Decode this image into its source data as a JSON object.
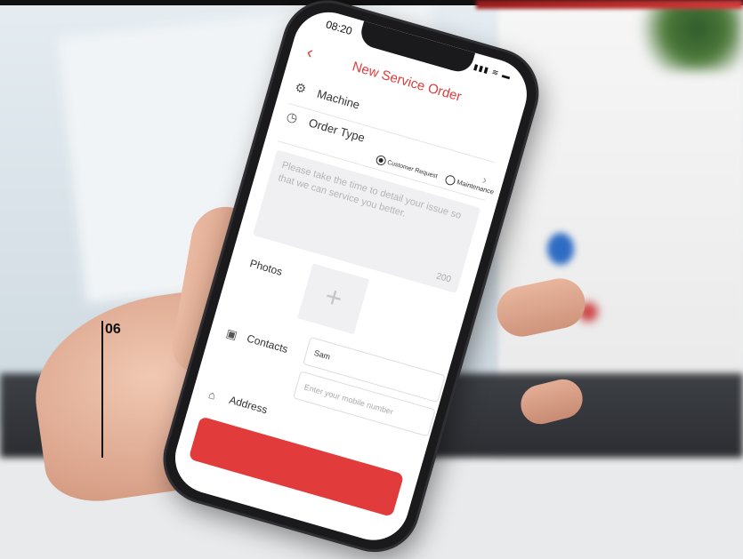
{
  "status": {
    "time": "08:20",
    "icons": "▮▮▮ ≋ ▬"
  },
  "header": {
    "back_icon": "chevron-left-icon",
    "title": "New Service Order"
  },
  "machine": {
    "label": "Machine"
  },
  "order_type": {
    "label": "Order Type",
    "options": [
      "Customer Request",
      "Maintenance"
    ],
    "selected": "Customer Request"
  },
  "issue": {
    "placeholder": "Please take the time to detail your issue so that we can service you better.",
    "counter": "200"
  },
  "photos": {
    "label": "Photos"
  },
  "contacts": {
    "label": "Contacts",
    "name_value": "Sam",
    "mobile_placeholder": "Enter your mobile number"
  },
  "address": {
    "label": "Address"
  },
  "overlay": {
    "step": "06"
  },
  "colors": {
    "accent": "#e23b3b"
  }
}
